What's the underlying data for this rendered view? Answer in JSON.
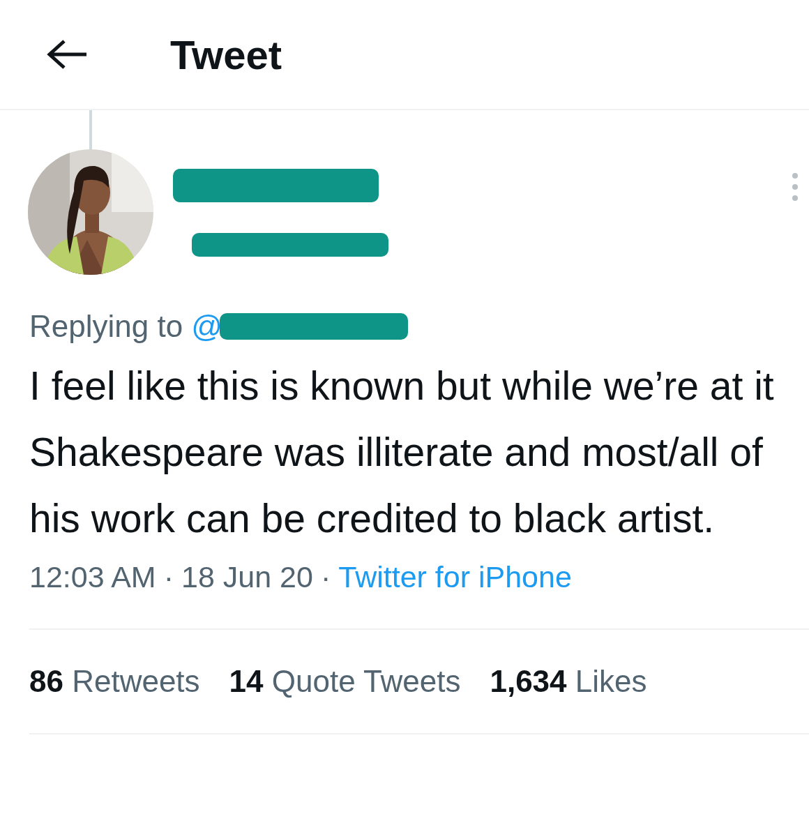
{
  "header": {
    "title": "Tweet"
  },
  "tweet": {
    "replying_prefix": "Replying to",
    "replying_at": "@",
    "text": "I feel like this is known but while we’re at it Shakespeare was illiterate and most/all of his work can be credited to black artist.",
    "time": "12:03 AM",
    "separator_1": "·",
    "date": "18 Jun 20",
    "separator_2": "·",
    "source": "Twitter for iPhone"
  },
  "stats": [
    {
      "count": "86",
      "label": "Retweets"
    },
    {
      "count": "14",
      "label": "Quote Tweets"
    },
    {
      "count": "1,634",
      "label": "Likes"
    }
  ]
}
